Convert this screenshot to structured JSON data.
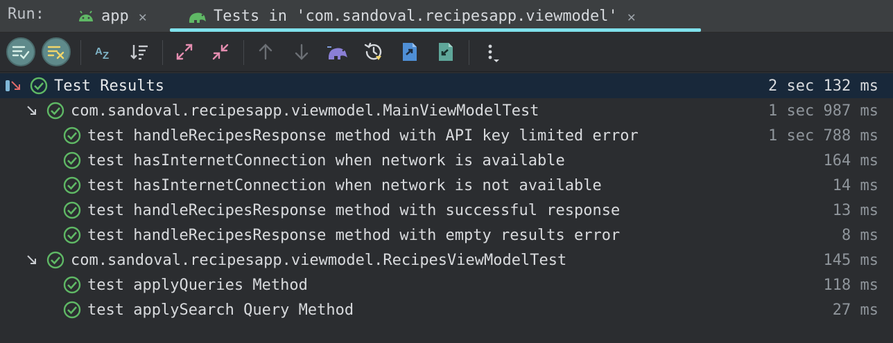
{
  "run": {
    "label": "Run:",
    "tabs": [
      {
        "label": "app",
        "icon": "android-icon"
      },
      {
        "label": "Tests in 'com.sandoval.recipesapp.viewmodel'",
        "icon": "android-test-icon"
      }
    ],
    "close_glyph": "✕"
  },
  "toolbar": {
    "buttons": [
      "show-passed-icon",
      "show-ignored-icon",
      "sort-alphabetically-icon",
      "sort-by-duration-icon",
      "expand-all-icon",
      "collapse-all-icon",
      "previous-failed-icon",
      "next-failed-icon",
      "import-tests-icon",
      "test-history-icon",
      "export-results-icon",
      "import-results-icon",
      "more-options-icon"
    ]
  },
  "tree": {
    "root": {
      "label": "Test Results",
      "time": "2 sec 132 ms"
    },
    "suites": [
      {
        "label": "com.sandoval.recipesapp.viewmodel.MainViewModelTest",
        "time": "1 sec 987 ms",
        "tests": [
          {
            "label": "test handleRecipesResponse method with API key limited error",
            "time": "1 sec 788 ms"
          },
          {
            "label": "test hasInternetConnection when network is available",
            "time": "164 ms"
          },
          {
            "label": "test hasInternetConnection when network is not available",
            "time": "14 ms"
          },
          {
            "label": "test handleRecipesResponse method with successful response",
            "time": "13 ms"
          },
          {
            "label": "test handleRecipesResponse method with empty results error",
            "time": "8 ms"
          }
        ]
      },
      {
        "label": "com.sandoval.recipesapp.viewmodel.RecipesViewModelTest",
        "time": "145 ms",
        "tests": [
          {
            "label": "test applyQueries Method",
            "time": "118 ms"
          },
          {
            "label": "test applySearch Query Method",
            "time": "27 ms"
          }
        ]
      }
    ]
  },
  "colors": {
    "pass_green": "#5fb865",
    "accent_cyan": "#7fe1ec",
    "selection": "#18283a"
  }
}
